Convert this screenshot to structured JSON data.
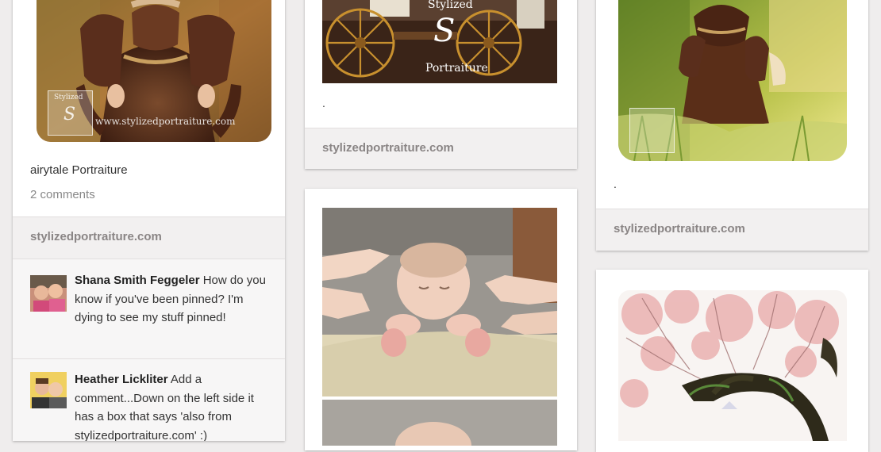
{
  "pins": {
    "pin1": {
      "caption": "airytale Portraiture",
      "comments_count": "2 comments",
      "source": "stylizedportraiture.com",
      "watermark_logo": "S",
      "watermark_small": "Stylized",
      "watermark_url": "www.stylizedportraiture.com",
      "comments": [
        {
          "author": "Shana Smith Feggeler",
          "text": "How do you know if you've been pinned? I'm dying to see my stuff pinned!"
        },
        {
          "author": "Heather Lickliter",
          "text": "Add a comment...Down on the left side it has a box that says 'also from stylizedportraiture.com' :)"
        }
      ]
    },
    "pin2": {
      "watermark_top": "Stylized",
      "watermark_logo": "S",
      "watermark_bottom": "Portraiture",
      "caption": ".",
      "source": "stylizedportraiture.com"
    },
    "pin3": {
      "caption": ".",
      "source": "stylizedportraiture.com"
    }
  },
  "colors": {
    "background": "#efeded",
    "source_bar": "#f2f0f0",
    "source_text": "#8a8585"
  }
}
